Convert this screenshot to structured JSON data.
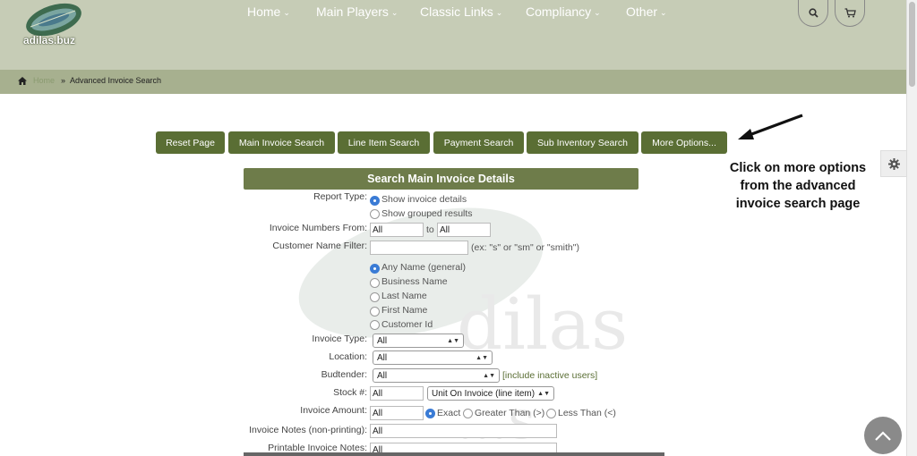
{
  "logo": {
    "text": "adilas.buz"
  },
  "nav": {
    "items": [
      {
        "label": "Home"
      },
      {
        "label": "Main Players"
      },
      {
        "label": "Classic Links"
      },
      {
        "label": "Compliancy"
      },
      {
        "label": "Other"
      }
    ]
  },
  "icons": {
    "search": "search-icon",
    "cart": "cart-icon",
    "home": "home-icon",
    "gear": "gear-icon",
    "up": "chevron-up-icon"
  },
  "breadcrumb": {
    "home": "Home",
    "sep": "»",
    "current": "Advanced Invoice Search"
  },
  "tabs": [
    {
      "label": "Reset Page"
    },
    {
      "label": "Main Invoice Search"
    },
    {
      "label": "Line Item Search"
    },
    {
      "label": "Payment Search"
    },
    {
      "label": "Sub Inventory Search"
    },
    {
      "label": "More Options..."
    }
  ],
  "annotation": {
    "line1": "Click on more options",
    "line2": "from the advanced",
    "line3": "invoice search page"
  },
  "form": {
    "title": "Search Main Invoice Details",
    "report_type": {
      "label": "Report Type:",
      "opt1": "Show invoice details",
      "opt2": "Show grouped results"
    },
    "invoice_numbers": {
      "label": "Invoice Numbers From:",
      "from": "All",
      "to_label": "to",
      "to": "All"
    },
    "customer_name": {
      "label": "Customer Name Filter:",
      "value": "",
      "hint": "(ex: \"s\" or \"sm\" or \"smith\")"
    },
    "name_options": [
      "Any Name (general)",
      "Business Name",
      "Last Name",
      "First Name",
      "Customer Id"
    ],
    "invoice_type": {
      "label": "Invoice Type:",
      "value": "All"
    },
    "location": {
      "label": "Location:",
      "value": "All"
    },
    "budtender": {
      "label": "Budtender:",
      "value": "All",
      "extra": "[include inactive users]"
    },
    "stock": {
      "label": "Stock #:",
      "value": "All",
      "select": "Unit On Invoice (line item)"
    },
    "invoice_amount": {
      "label": "Invoice Amount:",
      "value": "All",
      "exact": "Exact",
      "greater": "Greater Than (>)",
      "less": "Less Than (<)"
    },
    "notes_np": {
      "label": "Invoice Notes (non-printing):",
      "value": "All"
    },
    "notes_p": {
      "label": "Printable Invoice Notes:",
      "value": "All"
    }
  },
  "colors": {
    "header": "#c6ccb6",
    "breadcrumb": "#a7b08f",
    "button": "#5a6e34",
    "section": "#6e7c4a"
  }
}
